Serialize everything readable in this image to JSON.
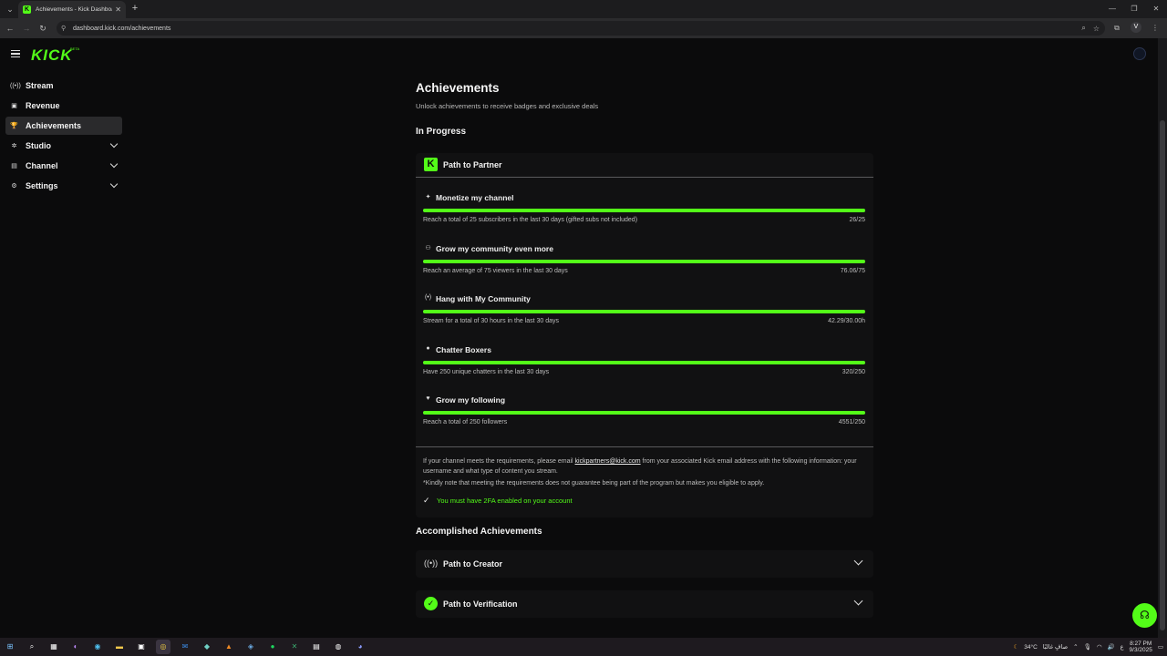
{
  "browser": {
    "tab_title": "Achievements - Kick Dashboard",
    "url": "dashboard.kick.com/achievements",
    "tab_close": "✕",
    "new_tab": "+"
  },
  "app": {
    "logo": "KICK",
    "logo_beta": "BETA",
    "brand_color": "#53fc18"
  },
  "sidebar": {
    "items": [
      {
        "label": "Stream",
        "icon": "broadcast-icon",
        "glyph": "((•))",
        "expandable": false,
        "active": false
      },
      {
        "label": "Revenue",
        "icon": "wallet-icon",
        "glyph": "▣",
        "expandable": false,
        "active": false
      },
      {
        "label": "Achievements",
        "icon": "trophy-icon",
        "glyph": "🏆",
        "expandable": false,
        "active": true
      },
      {
        "label": "Studio",
        "icon": "studio-icon",
        "glyph": "✲",
        "expandable": true,
        "active": false
      },
      {
        "label": "Channel",
        "icon": "channel-icon",
        "glyph": "▤",
        "expandable": true,
        "active": false
      },
      {
        "label": "Settings",
        "icon": "gear-icon",
        "glyph": "⚙",
        "expandable": true,
        "active": false
      }
    ]
  },
  "page": {
    "title": "Achievements",
    "subtitle": "Unlock achievements to receive badges and exclusive deals",
    "in_progress_title": "In Progress",
    "accomplished_title": "Accomplished Achievements"
  },
  "path_to_partner": {
    "title": "Path to Partner",
    "requirements": [
      {
        "title": "Monetize my channel",
        "icon": "sparkle-icon",
        "glyph": "✦",
        "description": "Reach a total of 25 subscribers in the last 30 days (gifted subs not included)",
        "progress": "26/25",
        "fill": 1.0
      },
      {
        "title": "Grow my community even more",
        "icon": "users-icon",
        "glyph": "⚇",
        "description": "Reach an average of 75 viewers in the last 30 days",
        "progress": "76.06/75",
        "fill": 1.0
      },
      {
        "title": "Hang with My Community",
        "icon": "broadcast-icon",
        "glyph": "(•)",
        "description": "Stream for a total of 30 hours in the last 30 days",
        "progress": "42.29/30.00h",
        "fill": 1.0
      },
      {
        "title": "Chatter Boxers",
        "icon": "chat-icon",
        "glyph": "●",
        "description": "Have 250 unique chatters in the last 30 days",
        "progress": "320/250",
        "fill": 1.0
      },
      {
        "title": "Grow my following",
        "icon": "heart-icon",
        "glyph": "♥",
        "description": "Reach a total of 250 followers",
        "progress": "4551/250",
        "fill": 1.0
      }
    ],
    "info_before": "If your channel meets the requirements, please email ",
    "info_email": "kickpartners@kick.com",
    "info_after": " from your associated Kick email address with the following information: your username and what type of content you stream.",
    "note": "*Kindly note that meeting the requirements does not guarantee being part of the program but makes you eligible to apply.",
    "twofa": "You must have 2FA enabled on your account"
  },
  "accomplished": [
    {
      "title": "Path to Creator",
      "icon": "broadcast-icon",
      "glyph": "((•))"
    },
    {
      "title": "Path to Verification",
      "icon": "verified-badge-icon",
      "glyph": "✓"
    }
  ],
  "taskbar": {
    "weather": "34°C",
    "weather_text": "صافٍ غالبًا",
    "time": "8:27 PM",
    "date": "9/3/2025"
  }
}
